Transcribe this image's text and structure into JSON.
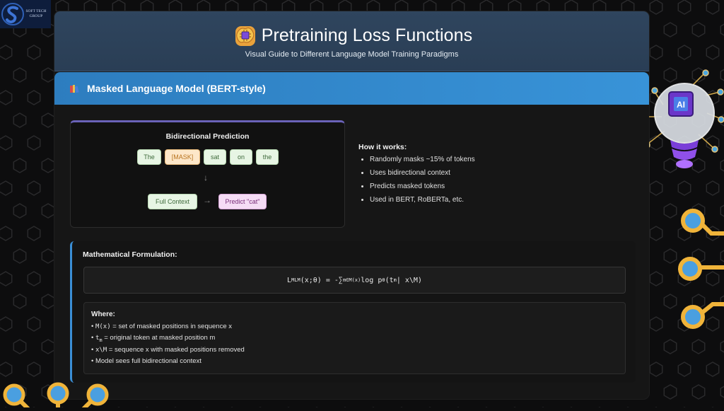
{
  "brand": {
    "line1": "SOFT TECH",
    "line2": "GROUP"
  },
  "header": {
    "title": "Pretraining Loss Functions",
    "subtitle": "Visual Guide to Different Language Model Training Paradigms"
  },
  "section": {
    "title": "Masked Language Model (BERT-style)"
  },
  "diagram": {
    "title": "Bidirectional Prediction",
    "tokens": [
      "The",
      "[MASK]",
      "sat",
      "on",
      "the"
    ],
    "down_arrow": "↓",
    "context_label": "Full Context",
    "right_arrow": "→",
    "predict_label": "Predict \"cat\""
  },
  "how_it_works": {
    "heading": "How it works:",
    "items": [
      "Randomly masks ~15% of tokens",
      "Uses bidirectional context",
      "Predicts masked tokens",
      "Used in BERT, RoBERTa, etc."
    ]
  },
  "math": {
    "heading": "Mathematical Formulation:",
    "formula_prefix": "L",
    "formula_sub1": "MLM",
    "formula_mid": "(x;θ) = -∑",
    "formula_sub2": "m∈M(x)",
    "formula_log": " log p",
    "formula_sub3": "θ",
    "formula_t": "(t",
    "formula_sub4": "m",
    "formula_end": " | x\\M)",
    "where_heading": "Where:",
    "where_items": [
      {
        "code": "M(x)",
        "text": " = set of masked positions in sequence x"
      },
      {
        "code": "t",
        "sub": "m",
        "text": " = original token at masked position m"
      },
      {
        "code": "x\\M",
        "text": " = sequence x with masked positions removed"
      },
      {
        "code": "",
        "text": "Model sees full bidirectional context"
      }
    ]
  },
  "decor": {
    "ai_badge": "AI"
  },
  "colors": {
    "header_bg": "#2f455e",
    "section_bar": "#3893d8",
    "accent_border": "#3a8fd6",
    "token_green": "#e7f5e4",
    "token_mask": "#fde7c9",
    "token_predict": "#f5dcf5",
    "circuit_gold": "#f0b43a",
    "circuit_blue": "#4a9fe0"
  }
}
